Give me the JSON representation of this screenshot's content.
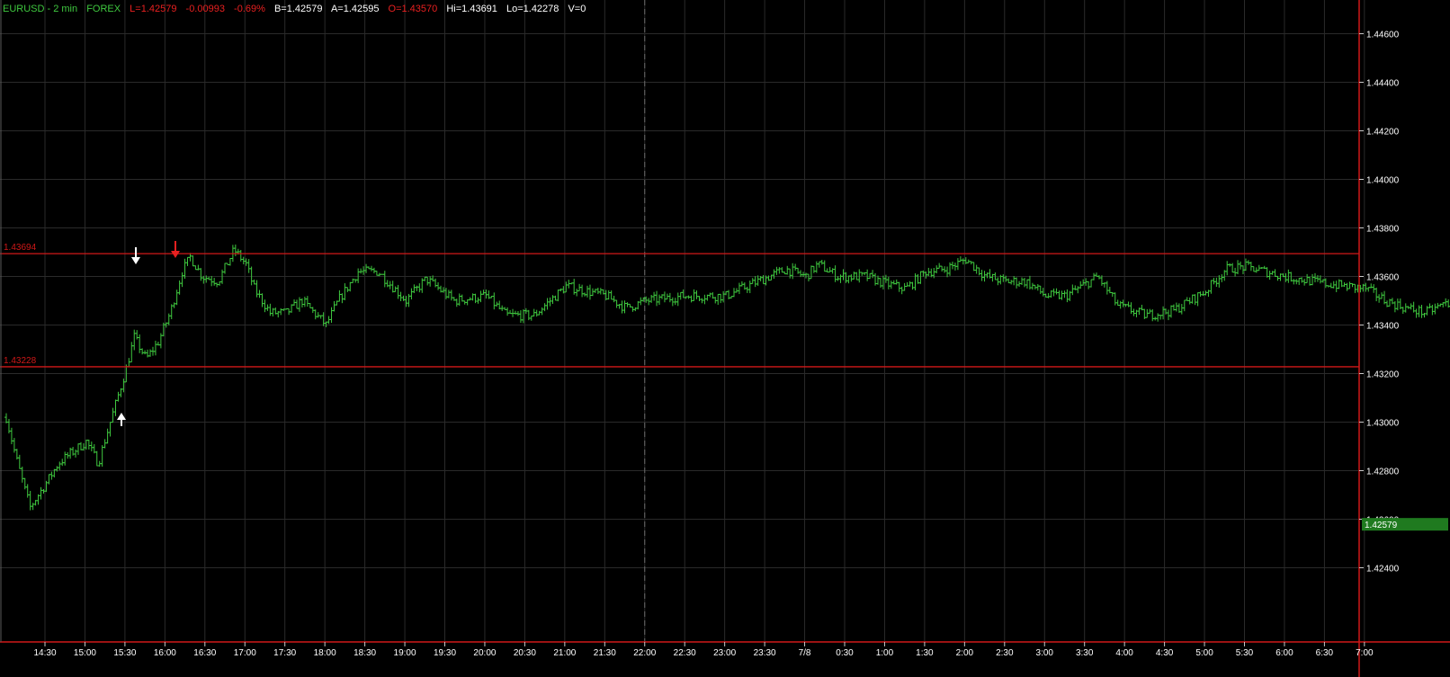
{
  "header": {
    "symbol": "EURUSD - 2 min",
    "exchange": "FOREX",
    "last": "L=1.42579",
    "change": "-0.00993",
    "change_pct": "-0.69%",
    "bid": "B=1.42579",
    "ask": "A=1.42595",
    "open": "O=1.43570",
    "high": "Hi=1.43691",
    "low": "Lo=1.42278",
    "volume": "V=0"
  },
  "colors": {
    "background": "#000000",
    "grid": "#2a2a2a",
    "bars": "#3fc83f",
    "level_lines": "#d01818",
    "axis_text": "#ffffff",
    "header_green": "#3fc83f",
    "header_red": "#e82020",
    "header_white": "#ffffff",
    "last_price_badge": "#1f7a1f"
  },
  "chart_data": {
    "type": "ohlc",
    "interval": "2 min",
    "y_ticks": [
      "1.44600",
      "1.44400",
      "1.44200",
      "1.44000",
      "1.43800",
      "1.43600",
      "1.43400",
      "1.43200",
      "1.43000",
      "1.42800",
      "1.42600",
      "1.42400"
    ],
    "ylim": [
      1.4219,
      1.447
    ],
    "x_ticks": [
      "14:30",
      "15:00",
      "15:30",
      "16:00",
      "16:30",
      "17:00",
      "17:30",
      "18:00",
      "18:30",
      "19:00",
      "19:30",
      "20:00",
      "20:30",
      "21:00",
      "21:30",
      "22:00",
      "22:30",
      "23:00",
      "23:30",
      "7/8",
      "0:30",
      "1:00",
      "1:30",
      "2:00",
      "2:30",
      "3:00",
      "3:30",
      "4:00",
      "4:30",
      "5:00",
      "5:30",
      "6:00",
      "6:30",
      "7:00"
    ],
    "horizontal_levels": [
      {
        "label": "1.43694",
        "value": 1.43694
      },
      {
        "label": "1.43228",
        "value": 1.43228
      }
    ],
    "session_divider_at": "22:00",
    "last_price": {
      "label": "1.42579",
      "value": 1.42579
    },
    "close_series": [
      {
        "t": 0,
        "v": 1.4302
      },
      {
        "t": 0.25,
        "v": 1.4285
      },
      {
        "t": 0.5,
        "v": 1.427
      },
      {
        "t": 0.6,
        "v": 1.4265
      },
      {
        "t": 1,
        "v": 1.4275
      },
      {
        "t": 1.3,
        "v": 1.4283
      },
      {
        "t": 1.6,
        "v": 1.4287
      },
      {
        "t": 2,
        "v": 1.4292
      },
      {
        "t": 2.3,
        "v": 1.4283
      },
      {
        "t": 2.6,
        "v": 1.43
      },
      {
        "t": 3,
        "v": 1.4322
      },
      {
        "t": 3.2,
        "v": 1.4335
      },
      {
        "t": 3.5,
        "v": 1.4326
      },
      {
        "t": 3.8,
        "v": 1.4333
      },
      {
        "t": 4.1,
        "v": 1.4345
      },
      {
        "t": 4.4,
        "v": 1.4362
      },
      {
        "t": 4.6,
        "v": 1.4368
      },
      {
        "t": 4.9,
        "v": 1.436
      },
      {
        "t": 5.3,
        "v": 1.4358
      },
      {
        "t": 5.7,
        "v": 1.4371
      },
      {
        "t": 6,
        "v": 1.4365
      },
      {
        "t": 6.2,
        "v": 1.4355
      },
      {
        "t": 6.6,
        "v": 1.4345
      },
      {
        "t": 7,
        "v": 1.4345
      },
      {
        "t": 7.4,
        "v": 1.435
      },
      {
        "t": 8,
        "v": 1.434
      },
      {
        "t": 8.3,
        "v": 1.435
      },
      {
        "t": 8.8,
        "v": 1.4362
      },
      {
        "t": 9.3,
        "v": 1.4362
      },
      {
        "t": 10,
        "v": 1.435
      },
      {
        "t": 10.5,
        "v": 1.4359
      },
      {
        "t": 11.2,
        "v": 1.435
      },
      {
        "t": 12,
        "v": 1.4352
      },
      {
        "t": 12.5,
        "v": 1.4344
      },
      {
        "t": 13.2,
        "v": 1.4344
      },
      {
        "t": 14,
        "v": 1.4356
      },
      {
        "t": 15,
        "v": 1.4352
      },
      {
        "t": 15.5,
        "v": 1.4347
      },
      {
        "t": 16,
        "v": 1.435
      },
      {
        "t": 17,
        "v": 1.4352
      },
      {
        "t": 18,
        "v": 1.4352
      },
      {
        "t": 18.8,
        "v": 1.4358
      },
      {
        "t": 19.5,
        "v": 1.4363
      },
      {
        "t": 20,
        "v": 1.436
      },
      {
        "t": 20.3,
        "v": 1.4365
      },
      {
        "t": 20.8,
        "v": 1.436
      },
      {
        "t": 21.5,
        "v": 1.436
      },
      {
        "t": 22,
        "v": 1.4357
      },
      {
        "t": 22.5,
        "v": 1.4355
      },
      {
        "t": 23,
        "v": 1.4362
      },
      {
        "t": 23.5,
        "v": 1.4363
      },
      {
        "t": 24,
        "v": 1.4367
      },
      {
        "t": 24.5,
        "v": 1.436
      },
      {
        "t": 25,
        "v": 1.4358
      },
      {
        "t": 25.5,
        "v": 1.4358
      },
      {
        "t": 26,
        "v": 1.4352
      },
      {
        "t": 26.5,
        "v": 1.4352
      },
      {
        "t": 27.3,
        "v": 1.436
      },
      {
        "t": 27.8,
        "v": 1.4348
      },
      {
        "t": 28.5,
        "v": 1.4344
      },
      {
        "t": 29.2,
        "v": 1.4346
      },
      {
        "t": 30,
        "v": 1.4354
      },
      {
        "t": 30.5,
        "v": 1.4363
      },
      {
        "t": 31,
        "v": 1.4364
      },
      {
        "t": 32,
        "v": 1.436
      },
      {
        "t": 33,
        "v": 1.4357
      },
      {
        "t": 34,
        "v": 1.4355
      },
      {
        "t": 34.5,
        "v": 1.435
      },
      {
        "t": 35,
        "v": 1.4347
      },
      {
        "t": 35.5,
        "v": 1.4345
      },
      {
        "t": 36,
        "v": 1.4349
      },
      {
        "t": 37,
        "v": 1.4346
      },
      {
        "t": 38,
        "v": 1.4342
      },
      {
        "t": 38.5,
        "v": 1.4336
      },
      {
        "t": 39,
        "v": 1.4338
      },
      {
        "t": 39.5,
        "v": 1.434
      },
      {
        "t": 40,
        "v": 1.4339
      },
      {
        "t": 40.5,
        "v": 1.4338
      },
      {
        "t": 41,
        "v": 1.434
      },
      {
        "t": 42,
        "v": 1.4342
      },
      {
        "t": 43,
        "v": 1.4345
      },
      {
        "t": 44,
        "v": 1.4341
      },
      {
        "t": 44.5,
        "v": 1.4345
      },
      {
        "t": 45,
        "v": 1.4352
      }
    ]
  }
}
